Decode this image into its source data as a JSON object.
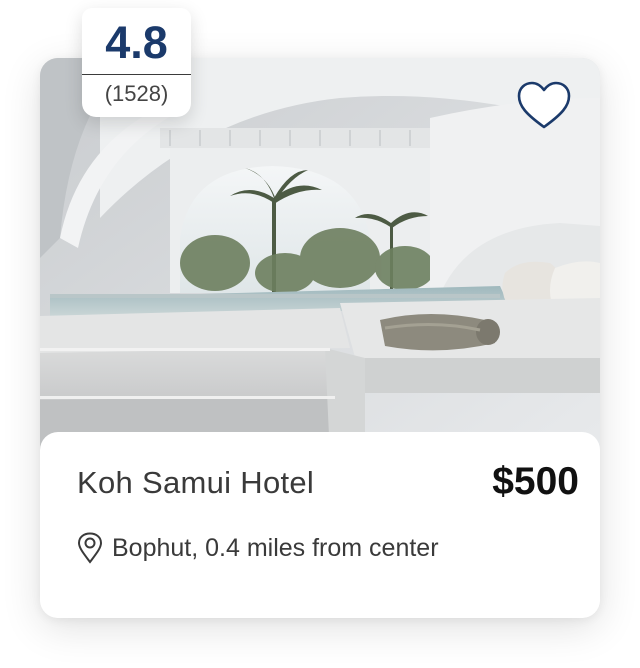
{
  "listing": {
    "name": "Koh Samui Hotel",
    "price": "$500",
    "location": "Bophut, 0.4 miles from center"
  },
  "rating": {
    "score": "4.8",
    "count": "(1528)"
  },
  "icons": {
    "favorite": "heart-icon",
    "location": "map-pin-icon"
  },
  "colors": {
    "rating_text": "#1b3a6b",
    "heart_outline": "#1b3a6b",
    "price_text": "#111111"
  }
}
